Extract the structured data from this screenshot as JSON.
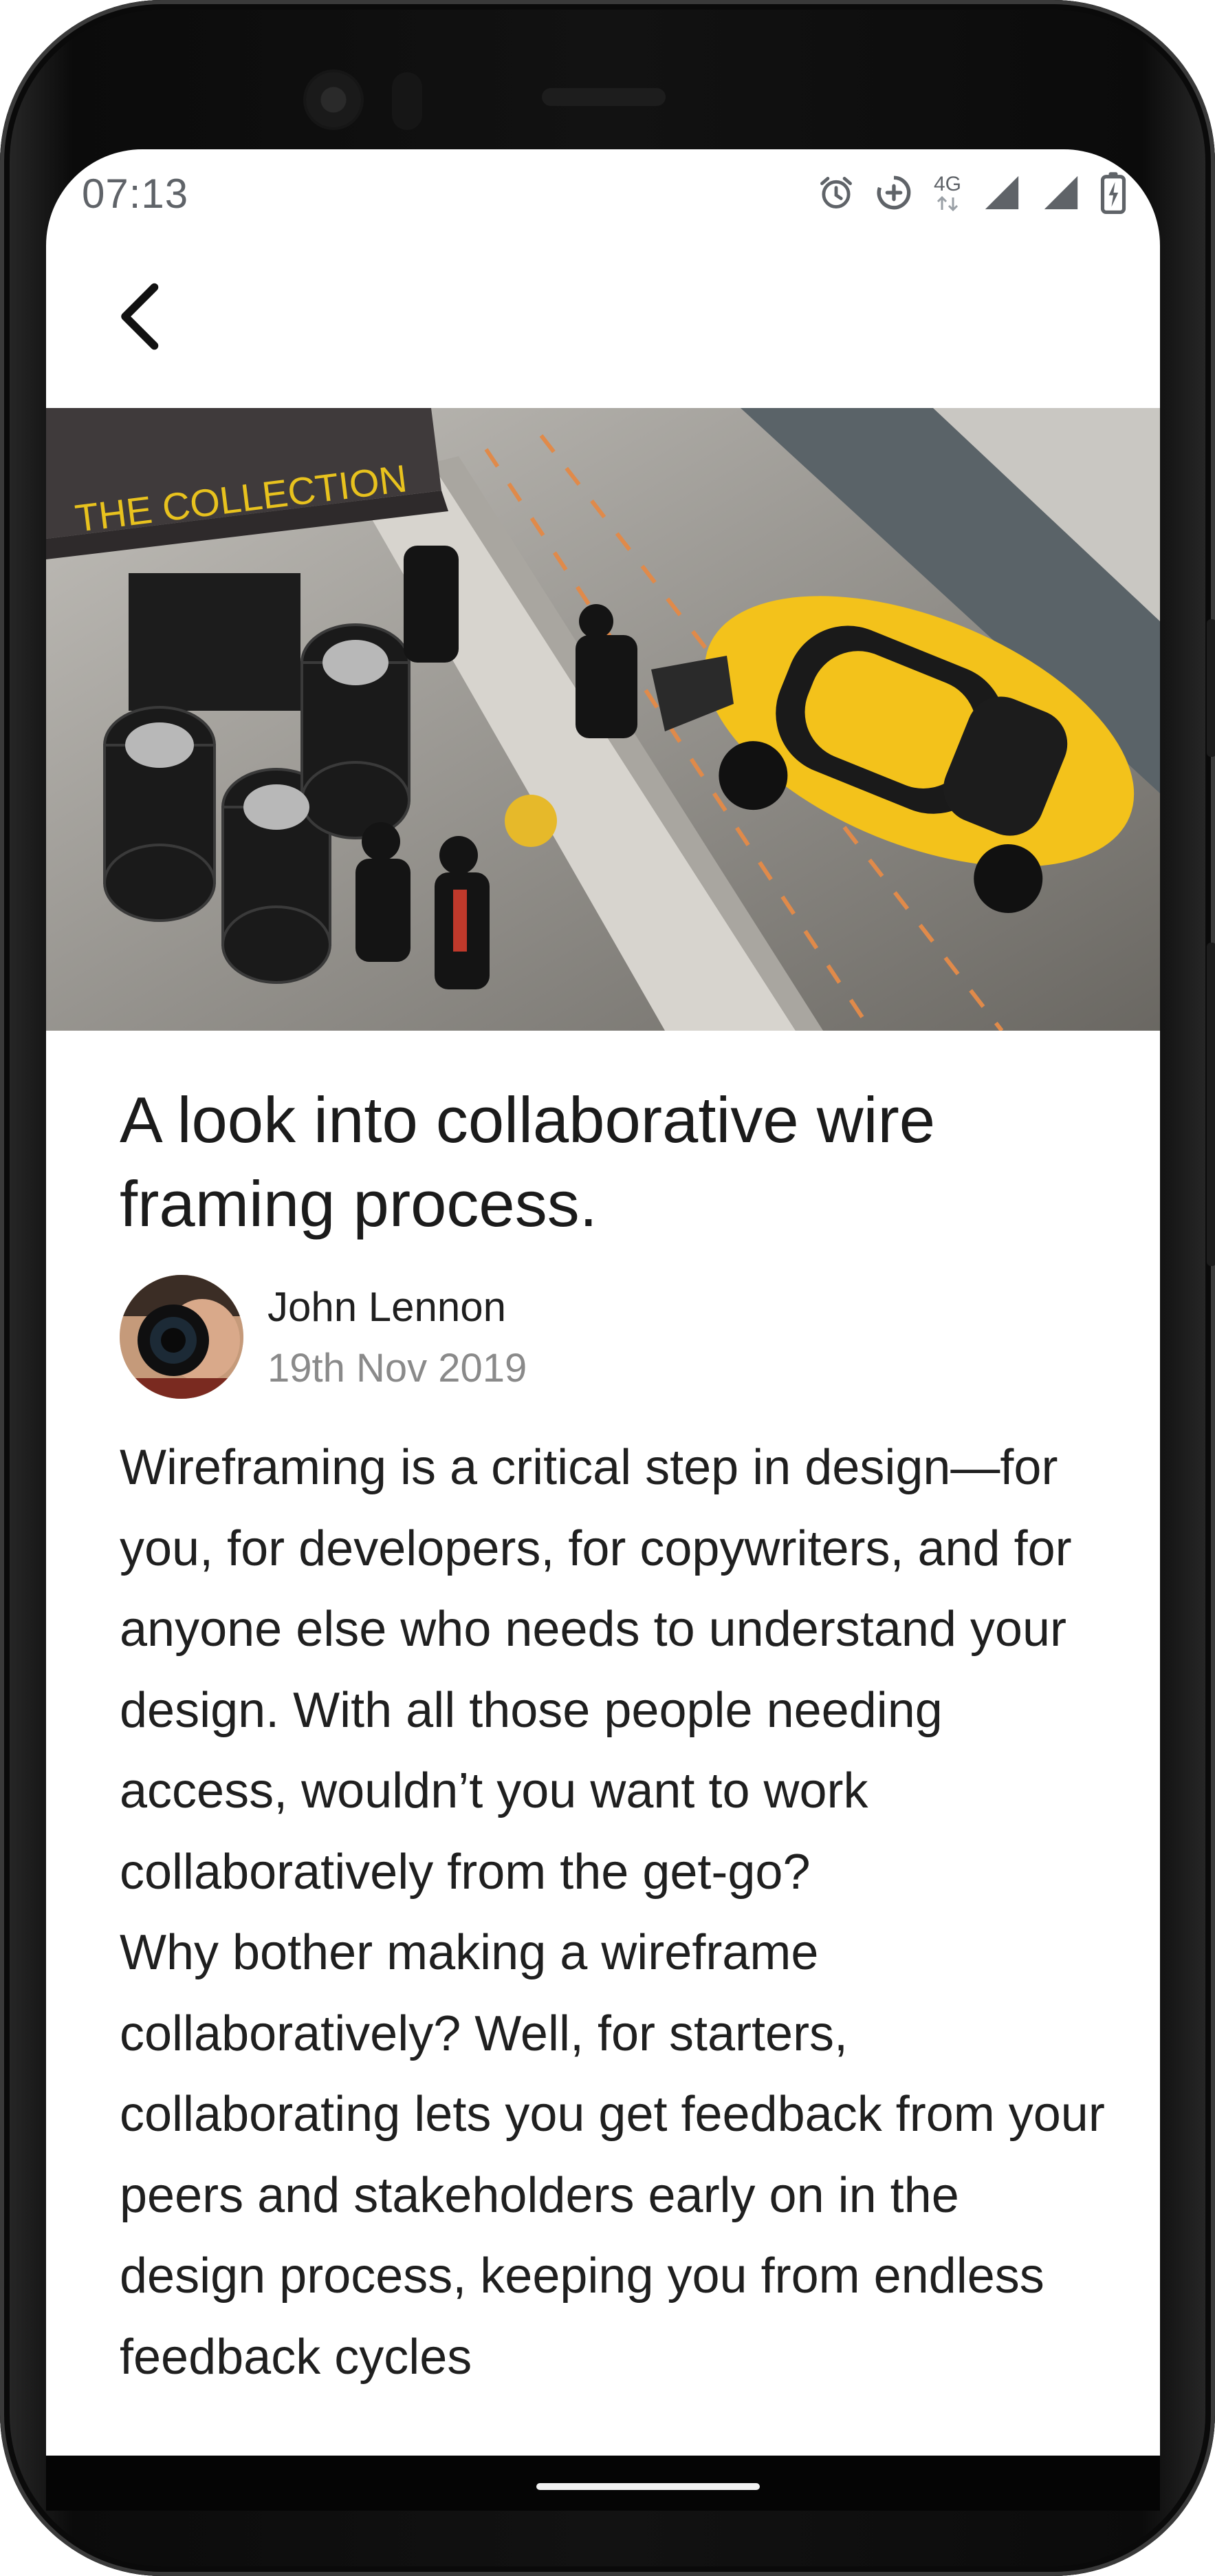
{
  "status_bar": {
    "time": "07:13",
    "network_label": "4G",
    "icons": [
      "alarm-icon",
      "data-saver-icon",
      "network-4g-icon",
      "signal-icon",
      "signal-icon",
      "battery-charging-icon"
    ]
  },
  "app_bar": {
    "back_icon": "chevron-left-icon"
  },
  "hero": {
    "image_description": "Race pit lane with tent, tires and a yellow sports car",
    "tent_text": "THE COLLECTION"
  },
  "article": {
    "title": "A look into collaborative wire framing process.",
    "author": {
      "name": "John Lennon",
      "date": "19th Nov 2019"
    },
    "body": [
      "Wireframing is a critical step in design—for you, for developers, for copywriters, and for anyone else who needs to understand your design. With all those people needing access, wouldn’t you want to work collaboratively from the get-go?",
      "Why bother making a wireframe collaboratively? Well, for starters, collaborating lets you get feedback from your peers and stakeholders early on in the design process, keeping you from endless feedback cycles"
    ]
  },
  "colors": {
    "frame": "#121212",
    "screen_background": "#ffffff",
    "title_text": "#1b1b1b",
    "secondary_text": "#8a8a8a",
    "status_text": "#5f6368",
    "car_yellow": "#f3c21b"
  }
}
